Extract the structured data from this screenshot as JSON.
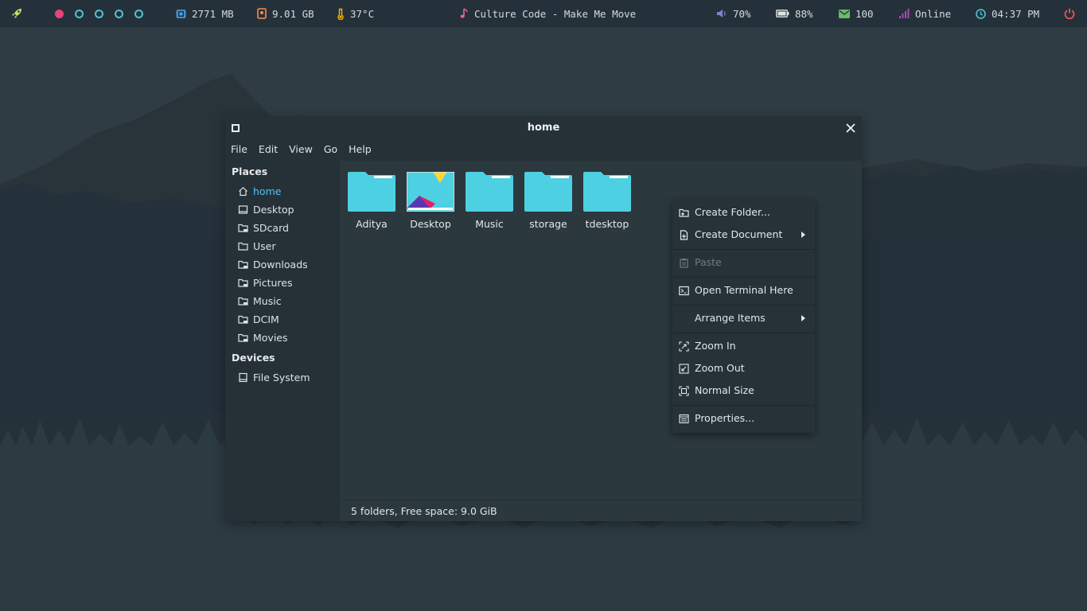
{
  "panel": {
    "colors": {
      "accent": "#4fc3d3",
      "active_workspace": "#ec407a",
      "bg": "#25313a"
    },
    "workspaces": [
      {
        "state": "active"
      },
      {
        "state": "inactive"
      },
      {
        "state": "inactive"
      },
      {
        "state": "inactive"
      },
      {
        "state": "inactive"
      }
    ],
    "memory": "2771 MB",
    "disk": "9.01 GB",
    "temperature": "37°C",
    "now_playing": "Culture Code - Make Me Move",
    "volume": "70%",
    "battery": "88%",
    "mail": "100",
    "network": "Online",
    "time": "04:37 PM",
    "icons": {
      "launcher": "rocket-icon",
      "memory": "chip-icon",
      "disk": "hdd-icon",
      "temperature": "thermometer-icon",
      "music": "music-note-icon",
      "volume": "speaker-icon",
      "battery": "battery-icon",
      "mail": "mail-icon",
      "network": "signal-icon",
      "time": "clock-icon",
      "power": "power-icon"
    }
  },
  "window": {
    "title": "home",
    "menu": [
      "File",
      "Edit",
      "View",
      "Go",
      "Help"
    ],
    "sidebar": {
      "places_heading": "Places",
      "places": [
        {
          "label": "home",
          "icon": "home-icon",
          "active": true
        },
        {
          "label": "Desktop",
          "icon": "desktop-icon"
        },
        {
          "label": "SDcard",
          "icon": "sdcard-folder-icon"
        },
        {
          "label": "User",
          "icon": "folder-icon"
        },
        {
          "label": "Downloads",
          "icon": "downloads-folder-icon"
        },
        {
          "label": "Pictures",
          "icon": "pictures-folder-icon"
        },
        {
          "label": "Music",
          "icon": "music-folder-icon"
        },
        {
          "label": "DCIM",
          "icon": "dcim-folder-icon"
        },
        {
          "label": "Movies",
          "icon": "movies-folder-icon"
        }
      ],
      "devices_heading": "Devices",
      "devices": [
        {
          "label": "File System",
          "icon": "drive-icon"
        }
      ]
    },
    "files": [
      {
        "name": "Aditya",
        "icon": "folder-icon"
      },
      {
        "name": "Desktop",
        "icon": "desktop-folder-icon"
      },
      {
        "name": "Music",
        "icon": "folder-icon"
      },
      {
        "name": "storage",
        "icon": "folder-icon"
      },
      {
        "name": "tdesktop",
        "icon": "folder-icon"
      }
    ],
    "status": "5 folders, Free space: 9.0 GiB"
  },
  "context_menu": {
    "items": [
      {
        "label": "Create Folder...",
        "icon": "new-folder-icon"
      },
      {
        "label": "Create Document",
        "icon": "new-document-icon",
        "submenu": true
      },
      {
        "label": "Paste",
        "icon": "paste-icon",
        "disabled": true
      },
      {
        "label": "Open Terminal Here",
        "icon": "terminal-icon"
      },
      {
        "label": "Arrange Items",
        "submenu": true
      },
      {
        "label": "Zoom In",
        "icon": "zoom-in-icon"
      },
      {
        "label": "Zoom Out",
        "icon": "zoom-out-icon"
      },
      {
        "label": "Normal Size",
        "icon": "normal-size-icon"
      },
      {
        "label": "Properties...",
        "icon": "properties-icon"
      }
    ]
  },
  "theme": {
    "folder_color": "#4dd0e1",
    "highlight": "#4fc3f7"
  }
}
